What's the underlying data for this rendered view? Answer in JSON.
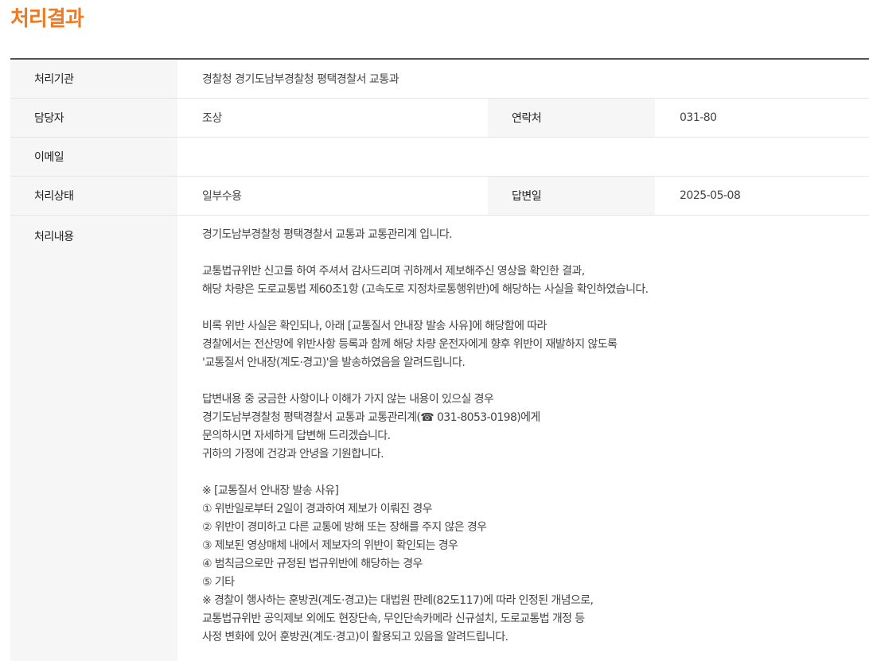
{
  "page": {
    "title": "처리결과"
  },
  "rows": {
    "agency": {
      "label": "처리기관",
      "value": "경찰청 경기도남부경찰청 평택경찰서 교통과"
    },
    "manager": {
      "label": "담당자",
      "value": "조상"
    },
    "contact": {
      "label": "연락처",
      "value": "031-80"
    },
    "email": {
      "label": "이메일",
      "value": ""
    },
    "status": {
      "label": "처리상태",
      "value": "일부수용"
    },
    "answer_date": {
      "label": "답변일",
      "value": "2025-05-08"
    },
    "content": {
      "label": "처리내용",
      "lines": [
        "경기도남부경찰청 평택경찰서 교통과 교통관리계 입니다.",
        "",
        "교통법규위반 신고를 하여 주셔서 감사드리며 귀하께서 제보해주신 영상을 확인한 결과,",
        "해당 차량은 도로교통법 제60조1항 (고속도로 지정차로통행위반)에 해당하는 사실을 확인하였습니다.",
        "",
        "비록 위반 사실은 확인되나, 아래 [교통질서 안내장 발송 사유]에 해당함에 따라",
        "경찰에서는 전산망에 위반사항 등록과 함께 해당 차량 운전자에게 향후 위반이 재발하지 않도록",
        "'교통질서 안내장(계도·경고)'을 발송하였음을 알려드립니다.",
        "",
        "답변내용 중 궁금한 사항이나 이해가 가지 않는 내용이 있으실 경우",
        "경기도남부경찰청 평택경찰서 교통과 교통관리계(☎ 031-8053-0198)에게",
        "문의하시면 자세하게 답변해 드리겠습니다.",
        "귀하의 가정에 건강과 안녕을 기원합니다.",
        "",
        "※ [교통질서 안내장 발송 사유]",
        "① 위반일로부터 2일이 경과하여 제보가 이뤄진 경우",
        "② 위반이 경미하고 다른 교통에 방해 또는 장해를 주지 않은 경우",
        "③ 제보된 영상매체 내에서 제보자의 위반이 확인되는 경우",
        "④ 범칙금으로만 규정된 법규위반에 해당하는 경우",
        "⑤ 기타",
        "※ 경찰이 행사하는 훈방권(계도·경고)는 대법원 판례(82도117)에 따라 인정된 개념으로,",
        "교통법규위반 공익제보 외에도 현장단속, 무인단속카메라 신규설치, 도로교통법 개정 등",
        "사정 변화에 있어 훈방권(계도·경고)이 활용되고 있음을 알려드립니다."
      ]
    }
  }
}
